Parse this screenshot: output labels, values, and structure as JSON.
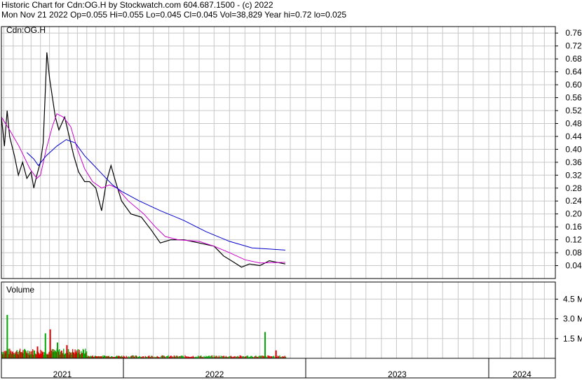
{
  "header": {
    "line1": "Historic Chart for Cdn:OG.H by Stockwatch.com 604.687.1500 - (c) 2022",
    "line2": "Mon Nov 21 2022  Op=0.055  Hi=0.055  Lo=0.045  Cl=0.045  Vol=38,829  Year hi=0.72  lo=0.025"
  },
  "chart_data": {
    "type": "line",
    "symbol_label": "Cdn:OG.H",
    "volume_label": "Volume",
    "price_axis": {
      "ticks": [
        "0.76",
        "0.72",
        "0.68",
        "0.64",
        "0.60",
        "0.56",
        "0.52",
        "0.48",
        "0.44",
        "0.40",
        "0.36",
        "0.32",
        "0.28",
        "0.24",
        "0.20",
        "0.16",
        "0.12",
        "0.08",
        "0.04"
      ],
      "ylim": [
        0.0,
        0.78
      ]
    },
    "volume_axis": {
      "ticks": [
        "4.5 M",
        "3.0 M",
        "1.5 M"
      ],
      "ylim": [
        0,
        5.8
      ]
    },
    "x_axis": {
      "year_labels": [
        "2021",
        "2022",
        "2023",
        "2024"
      ],
      "year_starts": [
        "2020-11-23",
        "2021-12-31",
        "2023-01-01",
        "2024-01-01",
        "2024-07-01"
      ]
    },
    "colors": {
      "price": "#000000",
      "ma_short": "#cc00cc",
      "ma_long": "#0000cc",
      "grid": "#c8c8c8",
      "vol_up": "#00aa00",
      "vol_down": "#dd0000"
    },
    "series": [
      {
        "key": "close",
        "points": [
          [
            "2020-11-23",
            0.5
          ],
          [
            "2020-12-03",
            0.41
          ],
          [
            "2020-12-12",
            0.52
          ],
          [
            "2020-12-20",
            0.44
          ],
          [
            "2021-01-05",
            0.38
          ],
          [
            "2021-01-18",
            0.32
          ],
          [
            "2021-02-01",
            0.36
          ],
          [
            "2021-02-15",
            0.31
          ],
          [
            "2021-03-01",
            0.33
          ],
          [
            "2021-03-10",
            0.28
          ],
          [
            "2021-03-20",
            0.32
          ],
          [
            "2021-04-01",
            0.36
          ],
          [
            "2021-04-10",
            0.42
          ],
          [
            "2021-04-18",
            0.6
          ],
          [
            "2021-04-22",
            0.7
          ],
          [
            "2021-05-01",
            0.62
          ],
          [
            "2021-05-20",
            0.5
          ],
          [
            "2021-06-01",
            0.46
          ],
          [
            "2021-06-20",
            0.5
          ],
          [
            "2021-07-05",
            0.44
          ],
          [
            "2021-07-20",
            0.38
          ],
          [
            "2021-08-05",
            0.33
          ],
          [
            "2021-08-25",
            0.3
          ],
          [
            "2021-09-10",
            0.3
          ],
          [
            "2021-10-01",
            0.28
          ],
          [
            "2021-10-20",
            0.21
          ],
          [
            "2021-11-05",
            0.3
          ],
          [
            "2021-11-20",
            0.35
          ],
          [
            "2021-12-05",
            0.3
          ],
          [
            "2021-12-25",
            0.24
          ],
          [
            "2022-01-15",
            0.2
          ],
          [
            "2022-02-05",
            0.19
          ],
          [
            "2022-02-25",
            0.15
          ],
          [
            "2022-03-15",
            0.11
          ],
          [
            "2022-04-05",
            0.12
          ],
          [
            "2022-05-01",
            0.12
          ],
          [
            "2022-06-01",
            0.11
          ],
          [
            "2022-07-01",
            0.1
          ],
          [
            "2022-07-20",
            0.07
          ],
          [
            "2022-08-10",
            0.05
          ],
          [
            "2022-08-25",
            0.035
          ],
          [
            "2022-09-10",
            0.045
          ],
          [
            "2022-10-01",
            0.04
          ],
          [
            "2022-10-20",
            0.055
          ],
          [
            "2022-11-21",
            0.045
          ]
        ]
      },
      {
        "key": "ma_short",
        "points": [
          [
            "2020-11-23",
            0.5
          ],
          [
            "2020-12-20",
            0.46
          ],
          [
            "2021-01-20",
            0.41
          ],
          [
            "2021-02-25",
            0.34
          ],
          [
            "2021-03-20",
            0.31
          ],
          [
            "2021-04-01",
            0.32
          ],
          [
            "2021-04-20",
            0.4
          ],
          [
            "2021-05-10",
            0.47
          ],
          [
            "2021-05-25",
            0.51
          ],
          [
            "2021-06-15",
            0.5
          ],
          [
            "2021-07-10",
            0.47
          ],
          [
            "2021-08-01",
            0.4
          ],
          [
            "2021-08-25",
            0.34
          ],
          [
            "2021-09-20",
            0.3
          ],
          [
            "2021-10-20",
            0.28
          ],
          [
            "2021-11-15",
            0.29
          ],
          [
            "2021-12-10",
            0.28
          ],
          [
            "2022-01-10",
            0.24
          ],
          [
            "2022-02-10",
            0.2
          ],
          [
            "2022-03-05",
            0.16
          ],
          [
            "2022-03-25",
            0.13
          ],
          [
            "2022-04-20",
            0.12
          ],
          [
            "2022-06-01",
            0.115
          ],
          [
            "2022-07-01",
            0.1
          ],
          [
            "2022-08-01",
            0.08
          ],
          [
            "2022-09-01",
            0.058
          ],
          [
            "2022-10-01",
            0.048
          ],
          [
            "2022-11-21",
            0.05
          ]
        ]
      },
      {
        "key": "ma_long",
        "points": [
          [
            "2021-02-15",
            0.39
          ],
          [
            "2021-03-10",
            0.37
          ],
          [
            "2021-03-25",
            0.35
          ],
          [
            "2021-04-20",
            0.38
          ],
          [
            "2021-05-25",
            0.41
          ],
          [
            "2021-06-25",
            0.43
          ],
          [
            "2021-07-25",
            0.42
          ],
          [
            "2021-08-25",
            0.38
          ],
          [
            "2021-09-25",
            0.35
          ],
          [
            "2021-10-25",
            0.32
          ],
          [
            "2021-11-25",
            0.29
          ],
          [
            "2021-12-25",
            0.27
          ],
          [
            "2022-02-01",
            0.24
          ],
          [
            "2022-03-15",
            0.21
          ],
          [
            "2022-05-01",
            0.18
          ],
          [
            "2022-06-15",
            0.145
          ],
          [
            "2022-08-01",
            0.115
          ],
          [
            "2022-09-15",
            0.095
          ],
          [
            "2022-11-21",
            0.088
          ]
        ]
      }
    ],
    "volume_series": [
      [
        "2020-12-10",
        3.3
      ],
      [
        "2021-03-20",
        0.9
      ],
      [
        "2021-04-15",
        1.9
      ],
      [
        "2021-05-01",
        2.2
      ],
      [
        "2021-05-25",
        1.2
      ],
      [
        "2021-06-25",
        1.0
      ],
      [
        "2022-10-10",
        2.0
      ],
      [
        "2022-11-01",
        0.6
      ]
    ]
  }
}
